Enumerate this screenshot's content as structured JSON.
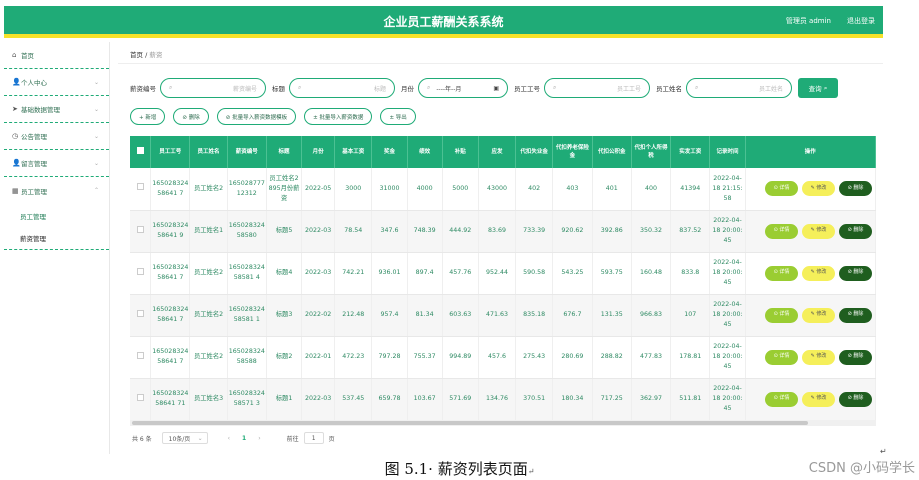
{
  "header": {
    "title": "企业员工薪酬关系系统",
    "admin": "管理员 admin",
    "logout": "退出登录"
  },
  "sidebar": {
    "items": [
      {
        "label": "首页",
        "icon": "home-icon",
        "glyph": "⌂"
      },
      {
        "label": "个人中心",
        "icon": "user-icon",
        "glyph": "👤"
      },
      {
        "label": "基础数据管理",
        "icon": "send-icon",
        "glyph": "➤"
      },
      {
        "label": "公告管理",
        "icon": "clock-icon",
        "glyph": "◷"
      },
      {
        "label": "留言管理",
        "icon": "user-icon",
        "glyph": "👤"
      },
      {
        "label": "员工管理",
        "icon": "grid-icon",
        "glyph": "▦"
      }
    ],
    "sub_items": [
      {
        "label": "员工管理"
      },
      {
        "label": "薪资管理"
      }
    ]
  },
  "breadcrumb": {
    "home": "首页",
    "sep": "/",
    "current": "薪资"
  },
  "search": {
    "salary_no_label": "薪资编号",
    "salary_no_placeholder": "薪资编号",
    "title_label": "标题",
    "title_placeholder": "标题",
    "month_label": "月份",
    "month_placeholder": "----年--月",
    "emp_no_label": "员工工号",
    "emp_no_placeholder": "员工工号",
    "emp_name_label": "员工姓名",
    "emp_name_placeholder": "员工姓名",
    "query_label": "查询"
  },
  "actions": {
    "add": "+ 新增",
    "delete": "⊘ 删除",
    "import_template": "⊘ 批量导入薪资数据模板",
    "import_data": "± 批量导入薪资数据",
    "export": "± 导出"
  },
  "table": {
    "headers": [
      "员工工号",
      "员工姓名",
      "薪资编号",
      "标题",
      "月份",
      "基本工资",
      "奖金",
      "绩效",
      "补贴",
      "应发",
      "代扣失业金",
      "代扣养老保险金",
      "代扣公积金",
      "代扣个人所得税",
      "实发工资",
      "记录时间",
      "操作"
    ],
    "rows": [
      [
        "16502832458641 7",
        "员工姓名2",
        "16502877712312",
        "员工姓名2895月份薪资",
        "2022-05",
        "3000",
        "31000",
        "4000",
        "5000",
        "43000",
        "402",
        "403",
        "401",
        "400",
        "41394",
        "2022-04-18 21:15:58"
      ],
      [
        "16502832458641 9",
        "员工姓名1",
        "16502832458580",
        "标题5",
        "2022-03",
        "78.54",
        "347.6",
        "748.39",
        "444.92",
        "83.69",
        "733.39",
        "920.62",
        "392.86",
        "350.32",
        "837.52",
        "2022-04-18 20:00:45"
      ],
      [
        "16502832458641 7",
        "员工姓名2",
        "16502832458581 4",
        "标题4",
        "2022-03",
        "742.21",
        "936.01",
        "897.4",
        "457.76",
        "952.44",
        "590.58",
        "543.25",
        "593.75",
        "160.48",
        "833.8",
        "2022-04-18 20:00:45"
      ],
      [
        "16502832458641 7",
        "员工姓名2",
        "16502832458581 1",
        "标题3",
        "2022-02",
        "212.48",
        "957.4",
        "81.34",
        "603.63",
        "471.63",
        "835.18",
        "676.7",
        "131.35",
        "966.83",
        "107",
        "2022-04-18 20:00:45"
      ],
      [
        "16502832458641 7",
        "员工姓名2",
        "16502832458588",
        "标题2",
        "2022-01",
        "472.23",
        "797.28",
        "755.37",
        "994.89",
        "457.6",
        "275.43",
        "280.69",
        "288.82",
        "477.83",
        "178.81",
        "2022-04-18 20:00:45"
      ],
      [
        "16502832458641 71",
        "员工姓名3",
        "16502832458571 3",
        "标题1",
        "2022-03",
        "537.45",
        "659.78",
        "103.67",
        "571.69",
        "134.76",
        "370.51",
        "180.34",
        "717.25",
        "362.97",
        "511.81",
        "2022-04-18 20:00:45"
      ]
    ],
    "op_detail": "详情",
    "op_edit": "修改",
    "op_delete": "删除"
  },
  "pager": {
    "total": "共 6 条",
    "page_size": "10条/页",
    "prev": "‹",
    "current_page": "1",
    "next": "›",
    "goto_label": "前往",
    "goto_value": "1",
    "page_unit": "页"
  },
  "caption": {
    "text": "图 5.1· 薪资列表页面",
    "return_mark": "↵"
  },
  "watermark": "CSDN @小码学长",
  "colors": {
    "primary": "#1fab77",
    "accent_yellow": "#f5e22a",
    "detail": "#9acd32",
    "edit": "#f5ef5a",
    "delete": "#1f5e1f"
  }
}
